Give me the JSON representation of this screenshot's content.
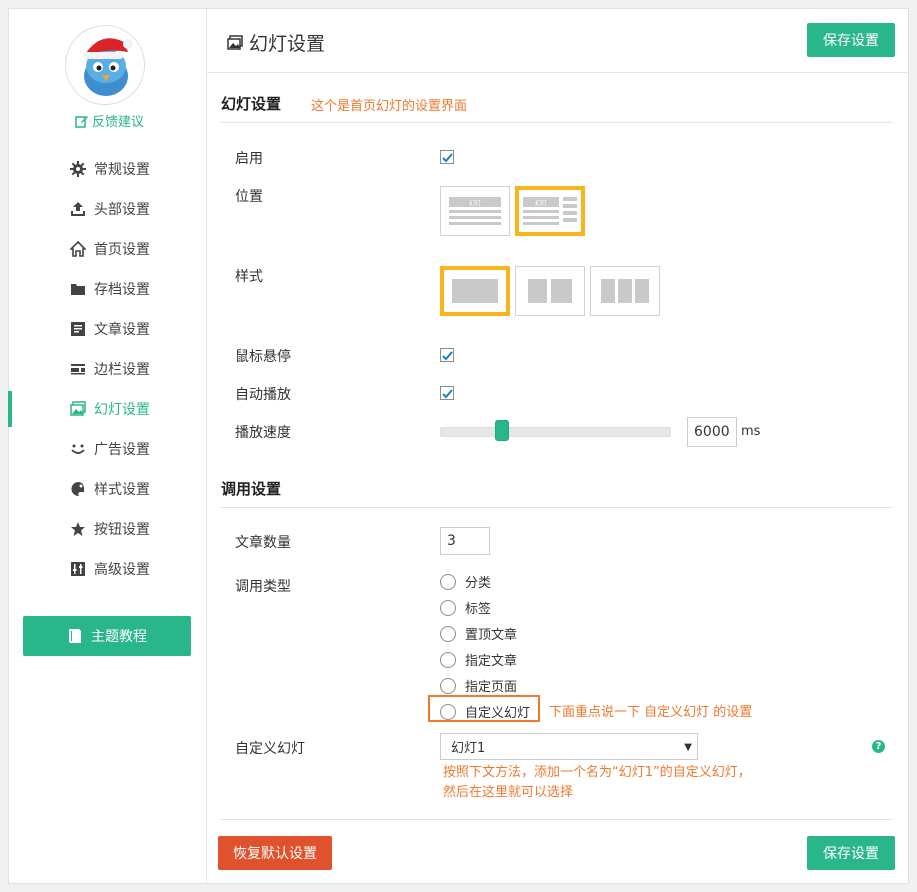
{
  "sidebar": {
    "feedback_label": "反馈建议",
    "menu": [
      {
        "label": "常规设置",
        "icon": "gear-icon"
      },
      {
        "label": "头部设置",
        "icon": "upload-icon"
      },
      {
        "label": "首页设置",
        "icon": "home-icon"
      },
      {
        "label": "存档设置",
        "icon": "folder-icon"
      },
      {
        "label": "文章设置",
        "icon": "document-icon"
      },
      {
        "label": "边栏设置",
        "icon": "sidebar-icon"
      },
      {
        "label": "幻灯设置",
        "icon": "slides-icon",
        "active": true
      },
      {
        "label": "广告设置",
        "icon": "smile-icon"
      },
      {
        "label": "样式设置",
        "icon": "palette-icon"
      },
      {
        "label": "按钮设置",
        "icon": "star-icon"
      },
      {
        "label": "高级设置",
        "icon": "advanced-icon"
      }
    ],
    "tutorial_label": "主题教程"
  },
  "header": {
    "title": "幻灯设置",
    "save_label": "保存设置"
  },
  "slide_section": {
    "title": "幻灯设置",
    "note": "这个是首页幻灯的设置界面",
    "enable_label": "启用",
    "enable_checked": true,
    "position_label": "位置",
    "position_option_text": "幻灯",
    "style_label": "样式",
    "hover_label": "鼠标悬停",
    "hover_checked": true,
    "autoplay_label": "自动播放",
    "autoplay_checked": true,
    "speed_label": "播放速度",
    "speed_value": "6000",
    "speed_unit": "ms"
  },
  "call_section": {
    "title": "调用设置",
    "count_label": "文章数量",
    "count_value": "3",
    "type_label": "调用类型",
    "types": [
      "分类",
      "标签",
      "置顶文章",
      "指定文章",
      "指定页面",
      "自定义幻灯"
    ],
    "type_note": "下面重点说一下 自定义幻灯 的设置",
    "custom_label": "自定义幻灯",
    "custom_selected": "幻灯1",
    "custom_hint": "按照下文方法，添加一个名为“幻灯1”的自定义幻灯，然后在这里就可以选择"
  },
  "footer": {
    "reset_label": "恢复默认设置",
    "save_label": "保存设置"
  },
  "colors": {
    "accent": "#2ab68b",
    "note": "#f0782f",
    "selected_border": "#f6b61a",
    "danger": "#e0522d"
  }
}
